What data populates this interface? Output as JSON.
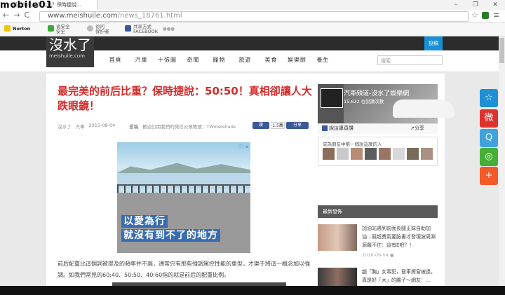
{
  "browser": {
    "tab_title": "最完美的前后比重？保時捷說…",
    "url_domain": "www.meishuile.com",
    "url_path": "/news_18761.html",
    "back": "←",
    "forward": "→",
    "reload": "C",
    "star": "☆",
    "menu": "≡",
    "win_min": "–",
    "win_max": "❐",
    "win_close": "✕",
    "bookmarks": [
      {
        "l1": "Norton",
        "l2": ""
      },
      {
        "l1": "说安全",
        "l2": "安全"
      },
      {
        "l1": "访问",
        "l2": "保护者"
      },
      {
        "l1": "共享方式",
        "l2": "FACEBOOK"
      }
    ],
    "bookmark_more": "●●●"
  },
  "watermark": "mobile01",
  "site": {
    "logo_text": "沒水了",
    "logo_url": "meishuile.com",
    "submit": "投稿",
    "menu": [
      "首頁",
      "汽車",
      "十張圖",
      "奇聞",
      "寵物",
      "旅遊",
      "美食",
      "娛樂眼",
      "養生"
    ],
    "search_placeholder": "搜索"
  },
  "article": {
    "title": "最完美的前后比重？保時捷說：50:50！真相卻讓人大跌眼鏡！",
    "author": "沒水了",
    "category": "汽車",
    "date": "2015-08-04",
    "submit_label": "投稿",
    "notice": "歡迎訂閱我們的微信公眾帳號：TWmeishuile",
    "like_label": "讚",
    "like_count": "1.5萬",
    "share_label": "分享",
    "ad_line1": "以愛為行",
    "ad_line2": "就沒有到不了的地方",
    "ad_icons": "ⓘ ✕",
    "paragraph": "前后配重比這個詞被提及的頻率并不高，通常只有那些強調駕控性能的車型，才樂于將這一概念加以強調。如我們常見的60:40、50:50、40:60指的就是前后的配重比例。"
  },
  "sidebar": {
    "fb_name": "汽車頻道-沒水了娛樂網",
    "fb_count": "15,632 位說讚次數",
    "fb_visit": "說這專頁讚",
    "fb_share": "分享",
    "friends_text": "成為朋友中第一個說這讚的人",
    "new_posts_title": "最新發佈",
    "posts": [
      {
        "text": "加油站遇到前面長腿正妹自助加油…競超勇氣要臉書才發現波周淵源羅不住：這有E吧？！",
        "date": "2016-09-04"
      },
      {
        "text": "趙「胸」女毒犯，竄車擦窗被逮，真是好「大」的膽子～網友：…",
        "date": ""
      }
    ]
  },
  "float_share": [
    "☆",
    "微",
    "Q",
    "◎",
    "+"
  ],
  "colors": {
    "title_red": "#d32b2b",
    "accent_blue": "#1a8fd8",
    "fb_blue": "#3b5998"
  }
}
